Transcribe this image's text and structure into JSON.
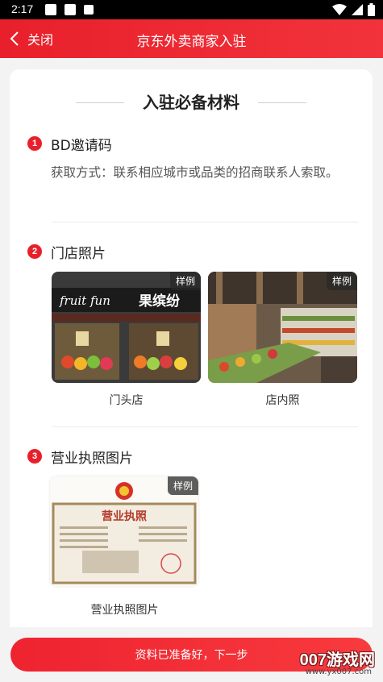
{
  "status_bar": {
    "time": "2:17"
  },
  "titlebar": {
    "back_label": "关闭",
    "title": "京东外卖商家入驻"
  },
  "section": {
    "title": "入驻必备材料"
  },
  "steps": [
    {
      "num": "1",
      "title": "BD邀请码",
      "desc": "获取方式：联系相应城市或品类的招商联系人索取。"
    },
    {
      "num": "2",
      "title": "门店照片",
      "photos": [
        {
          "badge": "样例",
          "caption": "门头店",
          "sign_left": "fruit fun",
          "sign_right": "果缤纷"
        },
        {
          "badge": "样例",
          "caption": "店内照"
        }
      ]
    },
    {
      "num": "3",
      "title": "营业执照图片",
      "license": {
        "badge": "样例",
        "caption": "营业执照图片",
        "heading": "营业执照"
      }
    }
  ],
  "bottom": {
    "next_label": "资料已准备好，下一步"
  },
  "watermark": {
    "brand": "007游戏网",
    "url": "www.yx007.com"
  }
}
